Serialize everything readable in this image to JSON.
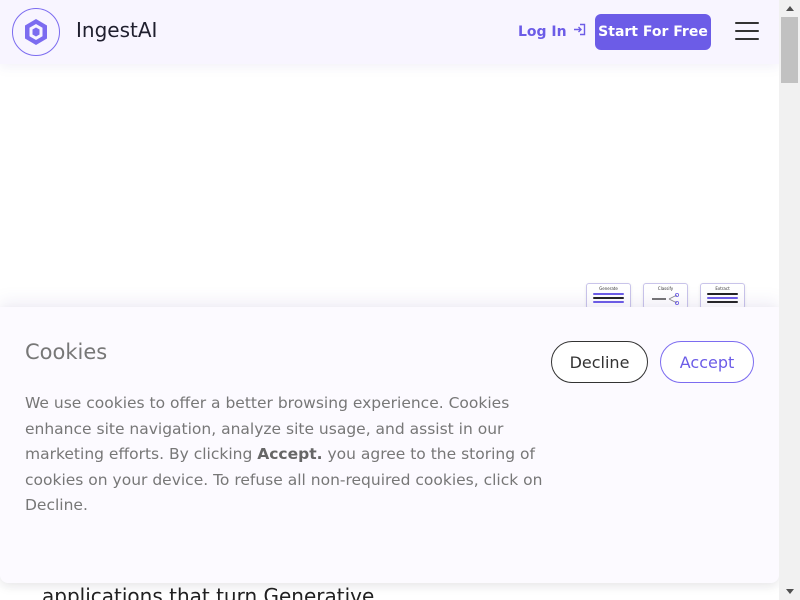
{
  "header": {
    "brand": "IngestAI",
    "login_label": "Log In",
    "start_label": "Start For Free",
    "accent_color": "#6c5ce7"
  },
  "thumbnails": [
    {
      "label": "Generate",
      "icon": "lines-icon"
    },
    {
      "label": "Classify",
      "icon": "share-icon"
    },
    {
      "label": "Extract",
      "icon": "lines-icon"
    }
  ],
  "hero": {
    "partial_text": "applications that turn Generative"
  },
  "cookie": {
    "title": "Cookies",
    "decline_label": "Decline",
    "accept_label": "Accept",
    "text_before": "We use cookies to offer a better browsing experience. Cookies enhance site navigation, analyze site usage, and assist in our marketing efforts. By clicking ",
    "text_bold": "Accept.",
    "text_after": " you agree to the storing of cookies on your device. To refuse all non-required cookies, click on Decline."
  },
  "icons": {
    "logo": "hexagon-logo-icon",
    "login": "login-arrow-icon",
    "menu": "hamburger-menu-icon"
  }
}
